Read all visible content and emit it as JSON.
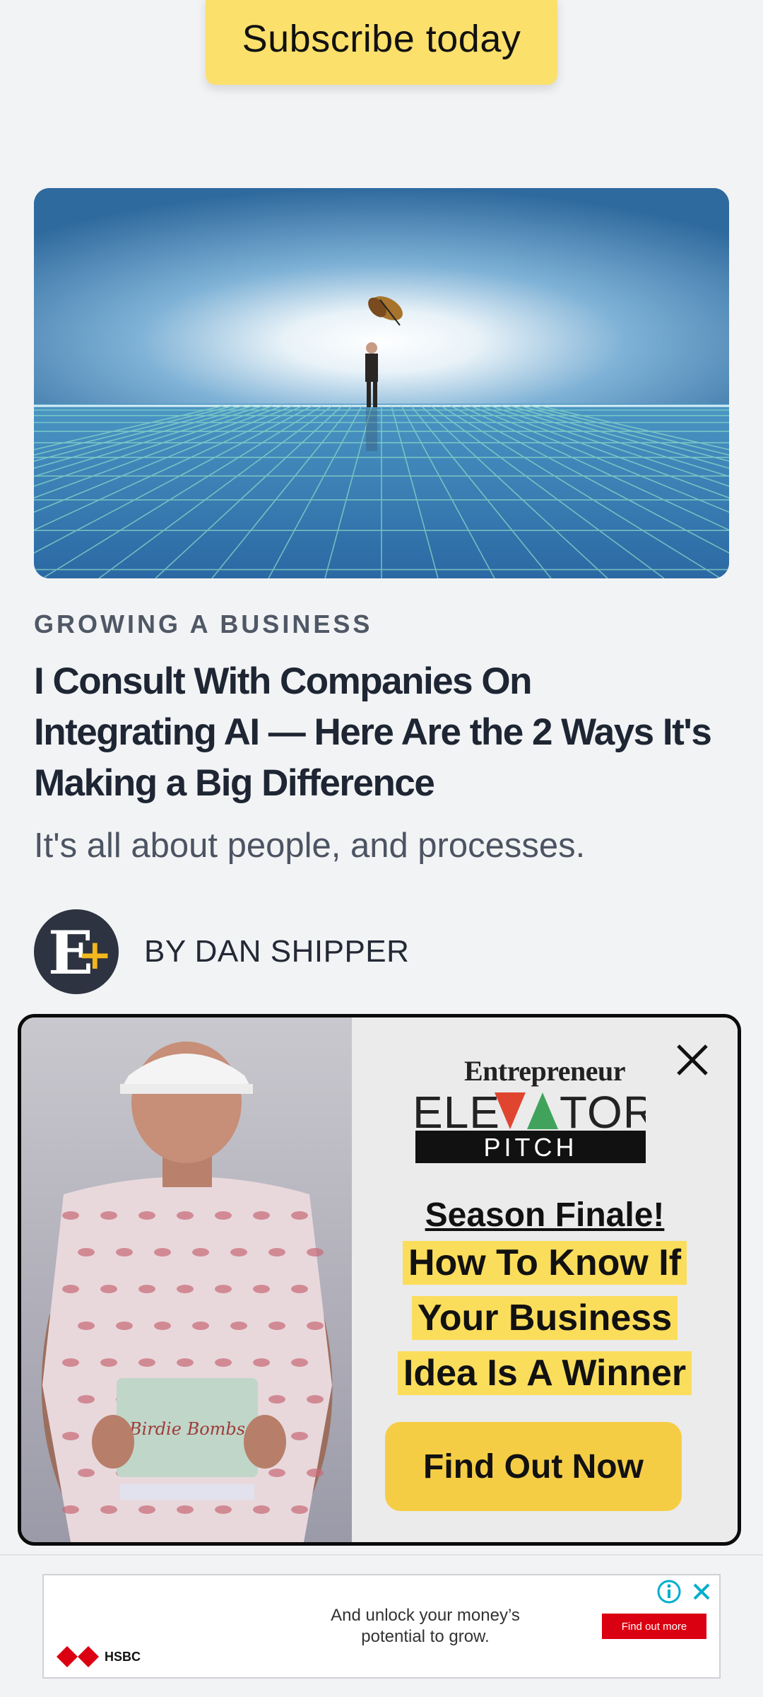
{
  "subscribe": {
    "label": "Subscribe today"
  },
  "article": {
    "category": "GROWING A BUSINESS",
    "headline_lines": [
      "I Consult With Companies On",
      "Integrating AI — Here Are the 2 Ways It's",
      "Making a Big Difference"
    ],
    "subhead": "It's all about people, and processes.",
    "author": "BY DAN SHIPPER"
  },
  "popup": {
    "brand_top": "Entrepreneur",
    "brand_mid": "ELEVATOR",
    "brand_pitch": "PITCH",
    "season": "Season Finale!",
    "highlight_lines": [
      "How To Know If",
      "Your Business",
      "Idea Is A Winner"
    ],
    "cta": "Find Out Now",
    "product_label": "Birdie Bombs"
  },
  "banner": {
    "text_line1": "And unlock your money’s",
    "text_line2": "potential to grow.",
    "cta": "Find out more",
    "brand": "HSBC"
  },
  "colors": {
    "subscribe_bg": "#fbe06c",
    "cta_bg": "#f5cd45",
    "highlight": "#fbdd5c",
    "hsbc_red": "#db0011",
    "ad_blue": "#00aecd"
  }
}
